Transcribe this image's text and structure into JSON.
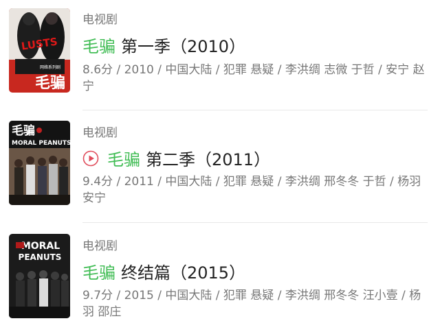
{
  "results": [
    {
      "category": "电视剧",
      "keyword": "毛骗",
      "title_rest": "第一季（2010）",
      "meta": "8.6分 / 2010 / 中国大陆 / 犯罪 悬疑 / 李洪绸 志微 于哲 / 安宁 赵宁",
      "poster": {
        "top_text": "LUSTS",
        "bottom_text": "毛骗",
        "small_text": "网络系列剧"
      }
    },
    {
      "category": "电视剧",
      "keyword": "毛骗",
      "title_rest": "第二季（2011）",
      "meta": "9.4分 / 2011 / 中国大陆 / 犯罪 悬疑 / 李洪绸 邢冬冬 于哲 / 杨羽 安宁",
      "has_play_icon": true,
      "poster": {
        "top_text": "毛骗",
        "sub_text": "MORAL PEANUTS"
      }
    },
    {
      "category": "电视剧",
      "keyword": "毛骗",
      "title_rest": "终结篇（2015）",
      "meta": "9.7分 / 2015 / 中国大陆 / 犯罪 悬疑 / 李洪绸 邢冬冬 汪小壹 / 杨羽 邵庄",
      "poster": {
        "top_text": "MORAL",
        "sub_text": "PEANUTS"
      }
    }
  ],
  "colors": {
    "keyword": "#42bd56",
    "meta": "#777777",
    "play_icon": "#e04b5a"
  }
}
